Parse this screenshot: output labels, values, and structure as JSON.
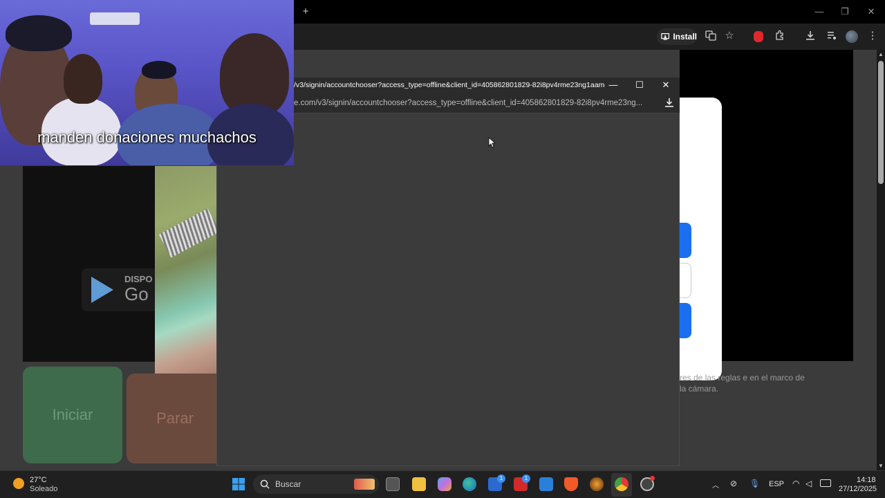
{
  "browser": {
    "new_tab_label": "+",
    "install_label": "Install",
    "window_controls": [
      "—",
      "❐",
      "✕"
    ]
  },
  "page": {
    "play_store_text1": "DISPO",
    "play_store_text2": "Go",
    "rules_text": "res de las reglas e en el marco de la cámara.",
    "start_button": "Iniciar",
    "stop_button": "Parar"
  },
  "webcam": {
    "caption": "manden donaciones muchachos"
  },
  "popup": {
    "title": "/v3/signin/accountchooser?access_type=offline&client_id=405862801829-82i8pv4rme23ng1aame...",
    "url": "e.com/v3/signin/accountchooser?access_type=offline&client_id=405862801829-82i8pv4rme23ng...",
    "controls": [
      "—",
      "☐",
      "✕"
    ]
  },
  "taskbar": {
    "weather_temp": "27°C",
    "weather_desc": "Soleado",
    "search_placeholder": "Buscar",
    "language": "ESP",
    "time": "14:18",
    "date": "27/12/2025",
    "badge_count_1": "1",
    "badge_count_2": "1"
  },
  "colors": {
    "accent_blue": "#1a6ff0",
    "start_green": "#3e6b4c",
    "stop_brown": "#6b4a3e"
  }
}
